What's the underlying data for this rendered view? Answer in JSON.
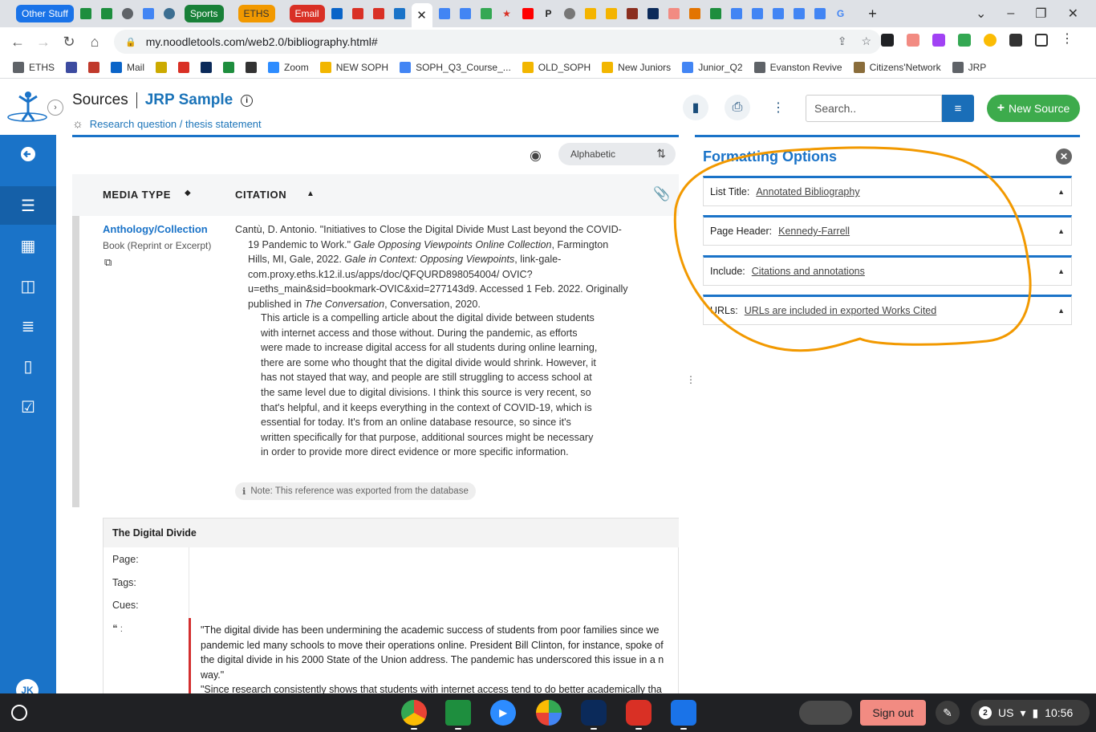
{
  "tabs": {
    "groups": [
      {
        "label": "Other Stuff",
        "color": "#1a73e8"
      },
      {
        "label": "Sports",
        "color": "#188038"
      },
      {
        "label": "ETHS",
        "color": "#f29900"
      },
      {
        "label": "Email",
        "color": "#d93025"
      }
    ],
    "active_close": "✕"
  },
  "browser": {
    "url": "my.noodletools.com/web2.0/bibliography.html#"
  },
  "bookmarks": [
    {
      "label": "ETHS",
      "icon": "folder-icon",
      "color": "#5f6368"
    },
    {
      "label": "",
      "icon": "calendar-icon",
      "color": "#3c4ba0"
    },
    {
      "label": "",
      "icon": "e-icon",
      "color": "#c0392b"
    },
    {
      "label": "Mail",
      "icon": "outlook-icon",
      "color": "#0a64c8"
    },
    {
      "label": "",
      "icon": "classroom-icon",
      "color": "#ccaa00"
    },
    {
      "label": "",
      "icon": "gmail-icon",
      "color": "#d93025"
    },
    {
      "label": "",
      "icon": "tac-icon",
      "color": "#0b2a5a"
    },
    {
      "label": "",
      "icon": "drive-icon",
      "color": "#1e8e3e"
    },
    {
      "label": "",
      "icon": "shield-icon",
      "color": "#333333"
    },
    {
      "label": "Zoom",
      "icon": "zoom-icon",
      "color": "#2d8cff"
    },
    {
      "label": "NEW SOPH",
      "icon": "folder-icon",
      "color": "#f2b600"
    },
    {
      "label": "SOPH_Q3_Course_...",
      "icon": "docs-icon",
      "color": "#4285f4"
    },
    {
      "label": "OLD_SOPH",
      "icon": "folder-icon",
      "color": "#f2b600"
    },
    {
      "label": "New Juniors",
      "icon": "folder-icon",
      "color": "#f2b600"
    },
    {
      "label": "Junior_Q2",
      "icon": "docs-icon",
      "color": "#4285f4"
    },
    {
      "label": "Evanston Revive",
      "icon": "folder-icon",
      "color": "#5f6368"
    },
    {
      "label": "Citizens'Network",
      "icon": "globe-icon",
      "color": "#8a6d3b"
    },
    {
      "label": "JRP",
      "icon": "folder-icon",
      "color": "#5f6368"
    }
  ],
  "header": {
    "section": "Sources",
    "project": "JRP Sample",
    "research_link": "Research question / thesis statement",
    "search_placeholder": "Search..",
    "new_source": "New Source"
  },
  "list": {
    "sort_label": "Alphabetic",
    "col_media": "MEDIA TYPE",
    "col_citation": "CITATION"
  },
  "source": {
    "media_type": "Anthology/Collection",
    "media_sub": "Book (Reprint or Excerpt)",
    "citation_parts": [
      "Cantù, D. Antonio. \"Initiatives to Close the Digital Divide Must Last beyond the COVID-19 Pandemic to Work.\" ",
      "Gale Opposing Viewpoints Online Collection",
      ", Farmington Hills, MI, Gale, 2022. ",
      "Gale in Context: Opposing Viewpoints",
      ", link-gale-com.proxy.eths.k12.il.us/apps/doc/QFQURD898054004/ OVIC?u=eths_main&sid=bookmark-OVIC&xid=277143d9. Accessed 1 Feb. 2022. Originally published in ",
      "The Conversation",
      ", Conversation, 2020."
    ],
    "annotation": "This article is a compelling article about the digital divide between students with internet access and those without. During the pandemic, as efforts were made to increase digital access for all students during online learning, there are some who thought that the digital divide would shrink. However, it has not stayed that way, and people are still struggling to access school at the same level due to digital divisions. I think this source is very recent, so that's helpful, and it keeps everything in the context of COVID-19, which is essential for today. It's from an online database resource, so since it's written specifically for that purpose, additional sources might be necessary in order to provide more direct evidence or more specific information.",
    "note": "Note: This reference was exported from the database"
  },
  "notecard": {
    "title": "The Digital Divide",
    "page_label": "Page:",
    "tags_label": "Tags:",
    "cues_label": "Cues:",
    "quote_label": ":",
    "quote_lines": [
      "\"The digital divide has been undermining the academic success of students from poor families since we",
      "pandemic led many schools to move their operations online. President Bill Clinton, for instance, spoke of",
      "the digital divide in his 2000 State of the Union address. The pandemic has underscored this issue in a n",
      "way.\"",
      "\"Since research consistently shows that students with internet access tend to do better academically tha"
    ]
  },
  "formatting": {
    "title": "Formatting Options",
    "items": [
      {
        "key": "List Title:",
        "value": "Annotated Bibliography"
      },
      {
        "key": "Page Header:",
        "value": "Kennedy-Farrell"
      },
      {
        "key": "Include:",
        "value": "Citations and annotations"
      },
      {
        "key": "URLs:",
        "value": "URLs are included in exported Works Cited"
      }
    ]
  },
  "sidebar": {
    "user_initials": "JK",
    "accent": "#1a73c8"
  },
  "shelf": {
    "sign_out": "Sign out",
    "notifications": "2",
    "keyboard": "US",
    "time": "10:56"
  },
  "colors": {
    "annotation_circle": "#f29900",
    "new_source": "#3dab4c",
    "quote_bar": "#d32f2f"
  }
}
